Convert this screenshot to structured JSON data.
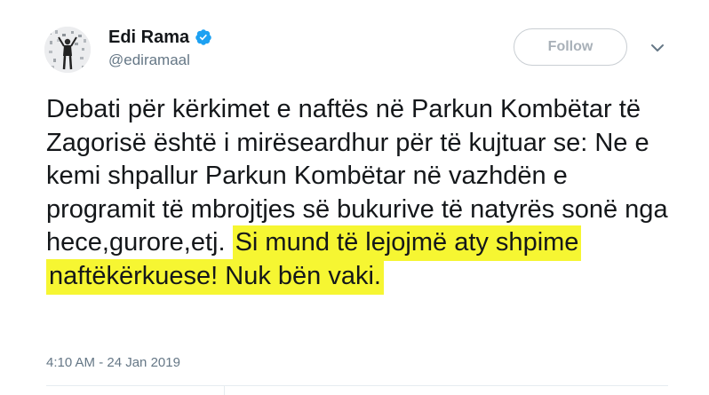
{
  "author": {
    "display_name": "Edi Rama",
    "handle": "@ediramaal",
    "verified_icon": "verified-badge-icon",
    "avatar_icon": "profile-photo"
  },
  "actions": {
    "follow_label": "Follow",
    "more_icon": "chevron-down-icon"
  },
  "tweet": {
    "text_plain": "Debati për kërkimet e naftës në Parkun Kombëtar të Zagorisë është i mirëseardhur për të kujtuar se: Ne e kemi shpallur Parkun Kombëtar në vazhdën e programit të mbrojtjes së bukurive të natyrës sonë nga hece,gurore,etj. ",
    "text_highlighted": "Si mund të lejojmë aty shpime naftëkërkuese! Nuk bën vaki.",
    "timestamp": "4:10 AM - 24 Jan 2019"
  },
  "colors": {
    "highlight": "#f6f632",
    "verified_blue": "#1da1f2",
    "text": "#14171a",
    "secondary_text": "#657786"
  }
}
